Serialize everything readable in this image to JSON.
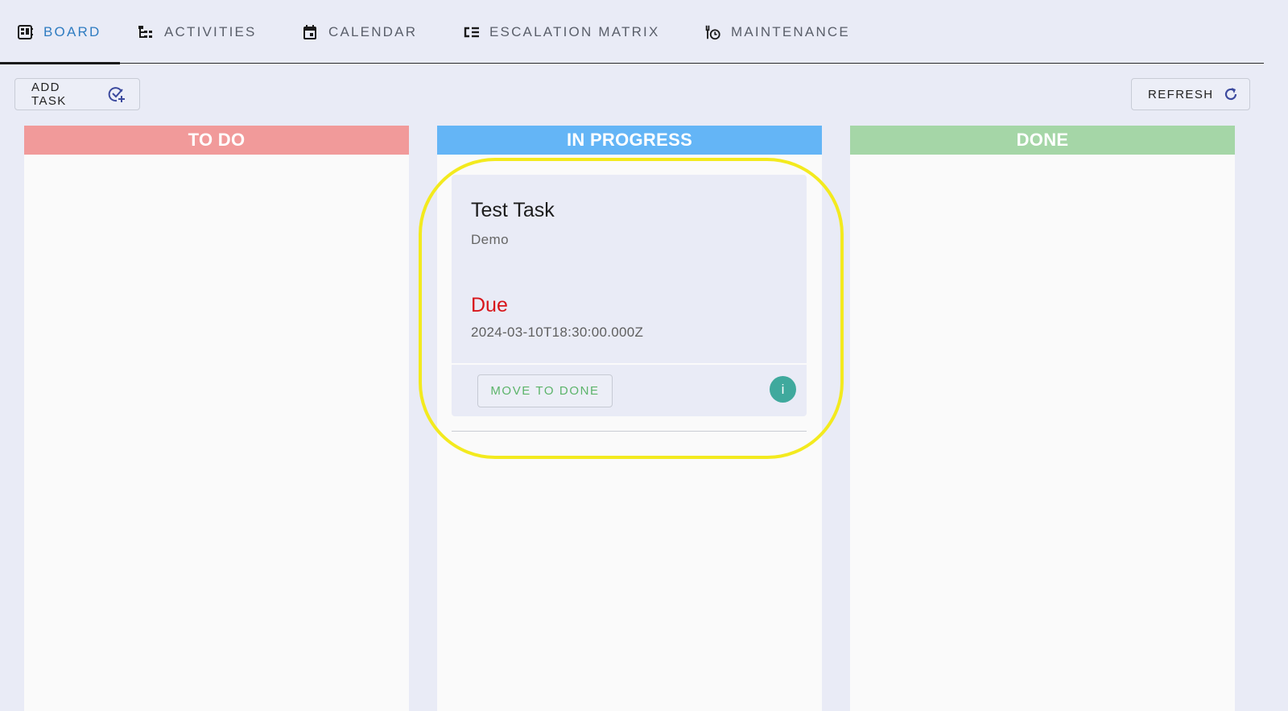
{
  "tabs": [
    {
      "label": "BOARD",
      "icon": "board-icon",
      "active": true
    },
    {
      "label": "ACTIVITIES",
      "icon": "activities-icon",
      "active": false
    },
    {
      "label": "CALENDAR",
      "icon": "calendar-icon",
      "active": false
    },
    {
      "label": "ESCALATION MATRIX",
      "icon": "escalation-icon",
      "active": false
    },
    {
      "label": "MAINTENANCE",
      "icon": "maintenance-icon",
      "active": false
    }
  ],
  "toolbar": {
    "add_task_label": "ADD TASK",
    "refresh_label": "REFRESH"
  },
  "columns": [
    {
      "title": "TO DO",
      "color": "#f19a9a"
    },
    {
      "title": "IN PROGRESS",
      "color": "#64b5f6"
    },
    {
      "title": "DONE",
      "color": "#a5d6a7"
    }
  ],
  "card": {
    "title": "Test Task",
    "subtitle": "Demo",
    "due_label": "Due",
    "due_date": "2024-03-10T18:30:00.000Z",
    "move_label": "MOVE TO DONE",
    "info_label": "i"
  },
  "colors": {
    "accent": "#2f7cc1",
    "due": "#d8161b",
    "move_button": "#5cb46a",
    "info": "#3fa99d",
    "highlight": "#f3ea1e"
  }
}
